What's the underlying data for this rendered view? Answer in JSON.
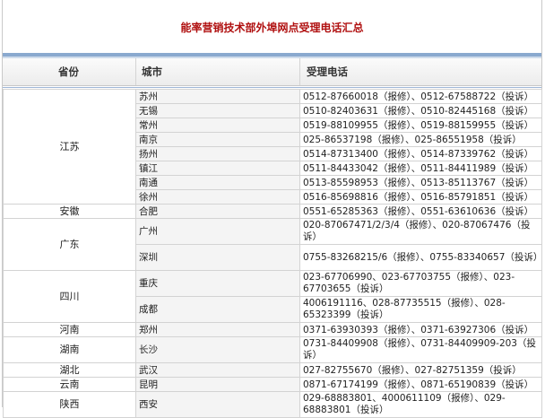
{
  "title": "能率营销技术部外埠网点受理电话汇总",
  "columns": {
    "province": "省份",
    "city": "城市",
    "phone": "受理电话"
  },
  "rows": [
    {
      "province": "江苏",
      "span": 8,
      "city": "苏州",
      "phone": "0512-87660018（报修）、0512-67588722（投诉）"
    },
    {
      "city": "无锡",
      "phone": "0510-82403631（报修）、0510-82445168（投诉）"
    },
    {
      "city": "常州",
      "phone": "0519-88109955（报修）、0519-88159955（投诉）"
    },
    {
      "city": "南京",
      "phone": "025-86537198（报修）、025-86551958（投诉）"
    },
    {
      "city": "扬州",
      "phone": "0514-87313400（报修）、0514-87339762（投诉）"
    },
    {
      "city": "镇江",
      "phone": "0511-84433042（报修）、0511-84411989（投诉）"
    },
    {
      "city": "南通",
      "phone": "0513-85598953（报修）、0513-85113767（投诉）"
    },
    {
      "city": "徐州",
      "phone": "0516-85698816（报修）、0516-85791851（投诉）"
    },
    {
      "province": "安徽",
      "span": 1,
      "city": "合肥",
      "phone": "0551-65285363（报修）、0551-63610636（投诉）"
    },
    {
      "province": "广东",
      "span": 2,
      "city": "广州",
      "phone": "020-87067471/2/3/4（报修）、020-87067476（投诉）",
      "wrap": true
    },
    {
      "city": "深圳",
      "phone": "0755-83268215/6（报修）、0755-83340657（投诉）",
      "wrap": true
    },
    {
      "province": "四川",
      "span": 2,
      "city": "重庆",
      "phone": "023-67706990、023-67703755（报修）、023-67703655（投诉）",
      "wrap": true
    },
    {
      "city": "成都",
      "phone": "4006191116、028-87735515（报修）、028-65323399（投诉）",
      "wrap": true
    },
    {
      "province": "河南",
      "span": 1,
      "city": "郑州",
      "phone": "0371-63930393（报修）、0371-63927306（投诉）"
    },
    {
      "province": "湖南",
      "span": 1,
      "city": "长沙",
      "phone": "0731-84409908（报修）、0731-84409909-203（投诉）",
      "wrap": true
    },
    {
      "province": "湖北",
      "span": 1,
      "city": "武汉",
      "phone": "027-82755670（报修）、027-82751359（投诉）"
    },
    {
      "province": "云南",
      "span": 1,
      "city": "昆明",
      "phone": "0871-67174199（报修）、0871-65190839（投诉）"
    },
    {
      "province": "陕西",
      "span": 1,
      "city": "西安",
      "phone": "029-68883801、4000611109（报修）、029-68883801（投诉）",
      "wrap": true
    }
  ]
}
